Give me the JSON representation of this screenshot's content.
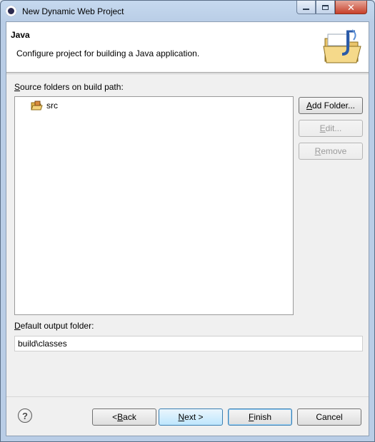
{
  "window": {
    "title": "New Dynamic Web Project"
  },
  "header": {
    "title": "Java",
    "description": "Configure project for building a Java application."
  },
  "source_folders": {
    "label_prefix": "",
    "label_mnemonic": "S",
    "label_rest": "ource folders on build path:",
    "items": [
      {
        "label": "src",
        "icon": "package-folder-icon"
      }
    ]
  },
  "side_buttons": {
    "add_folder": {
      "mnemonic": "A",
      "rest": "dd Folder..."
    },
    "edit": {
      "mnemonic": "E",
      "rest": "dit..."
    },
    "remove": {
      "mnemonic": "R",
      "rest": "emove"
    }
  },
  "output_folder": {
    "label_mnemonic": "D",
    "label_rest": "efault output folder:",
    "value": "build\\classes"
  },
  "footer": {
    "back": {
      "pre": "< ",
      "mnemonic": "B",
      "rest": "ack"
    },
    "next": {
      "mnemonic": "N",
      "rest": "ext >"
    },
    "finish": {
      "mnemonic": "F",
      "rest": "inish"
    },
    "cancel": "Cancel"
  },
  "colors": {
    "title_bar": "#c6d9ef",
    "close_button": "#c7402a",
    "focus_border": "#3c7fb1"
  }
}
